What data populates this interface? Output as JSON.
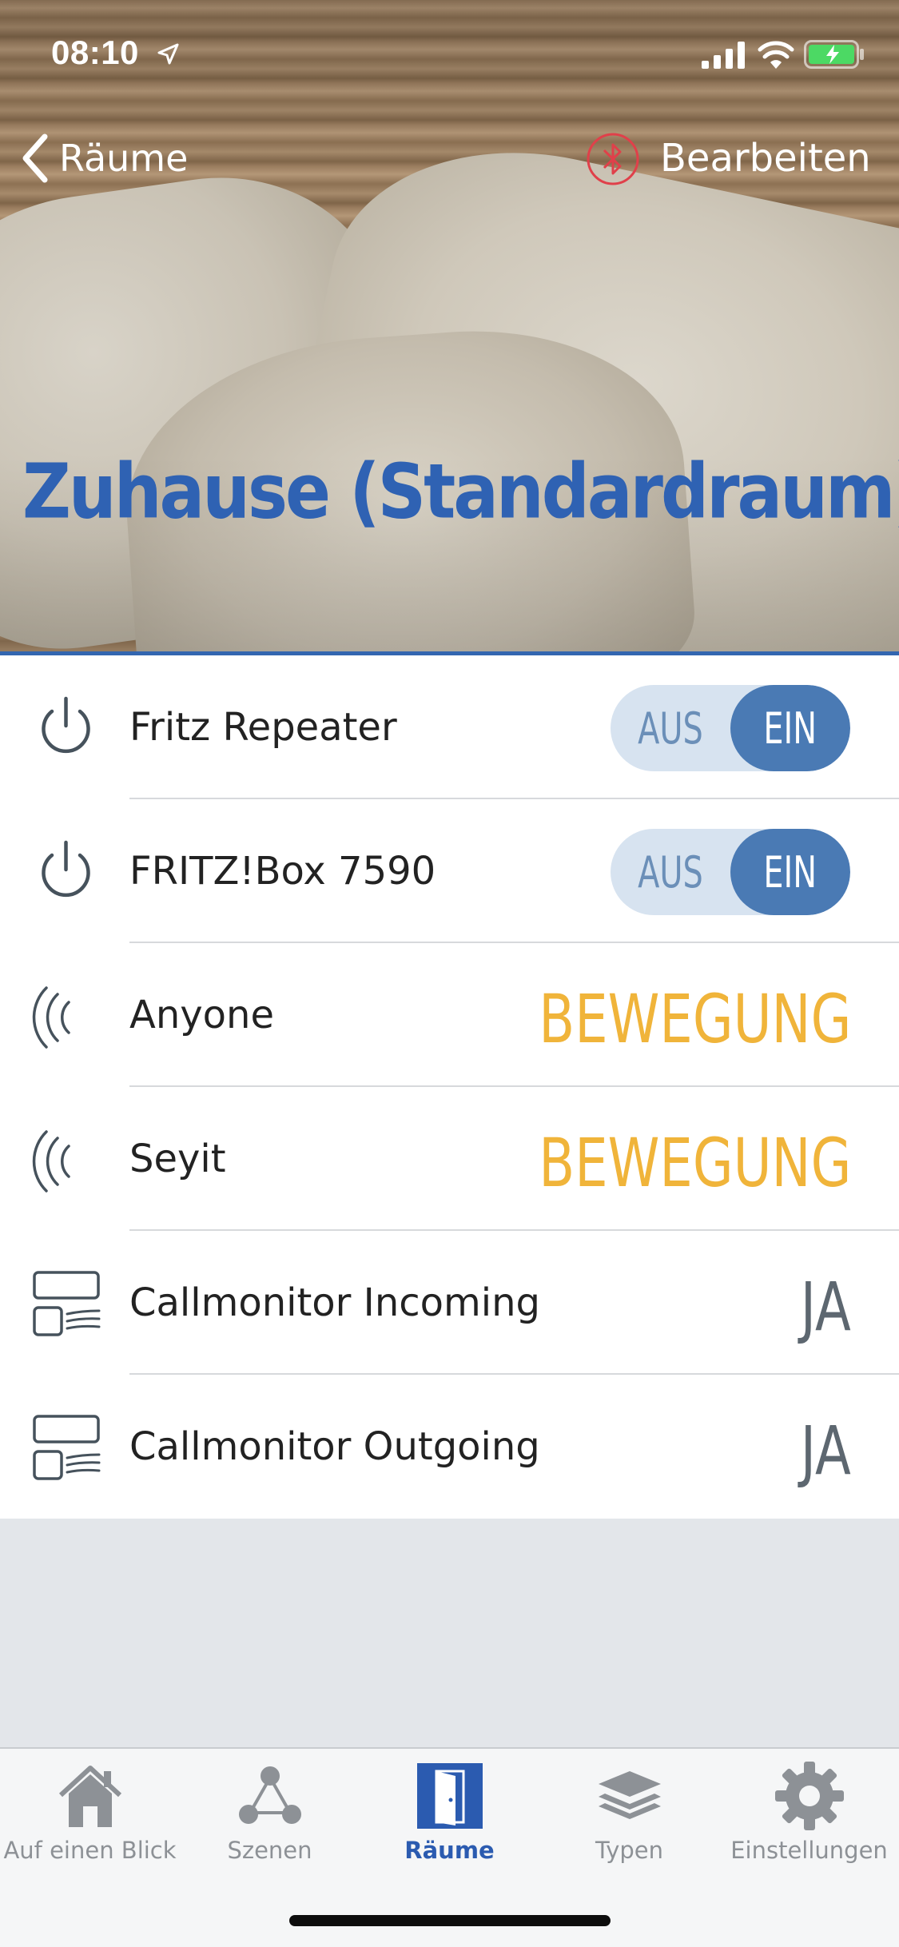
{
  "status_bar": {
    "time": "08:10"
  },
  "nav": {
    "back_label": "Räume",
    "edit_label": "Bearbeiten"
  },
  "room": {
    "title": "Zuhause (Standardraum)"
  },
  "devices": [
    {
      "name": "Fritz Repeater",
      "type": "switch",
      "off_label": "AUS",
      "on_label": "EIN",
      "state": "on",
      "icon": "power-icon"
    },
    {
      "name": "FRITZ!Box 7590",
      "type": "switch",
      "off_label": "AUS",
      "on_label": "EIN",
      "state": "on",
      "icon": "power-icon"
    },
    {
      "name": "Anyone",
      "type": "motion",
      "state_label": "BEWEGUNG",
      "icon": "motion-sensor-icon"
    },
    {
      "name": "Seyit",
      "type": "motion",
      "state_label": "BEWEGUNG",
      "icon": "motion-sensor-icon"
    },
    {
      "name": "Callmonitor Incoming",
      "type": "contact",
      "state_label": "JA",
      "icon": "callmonitor-icon"
    },
    {
      "name": "Callmonitor Outgoing",
      "type": "contact",
      "state_label": "JA",
      "icon": "callmonitor-icon"
    }
  ],
  "tabs": [
    {
      "label": "Auf einen Blick",
      "icon": "house-icon",
      "active": false
    },
    {
      "label": "Szenen",
      "icon": "scenes-icon",
      "active": false
    },
    {
      "label": "Räume",
      "icon": "door-icon",
      "active": true
    },
    {
      "label": "Typen",
      "icon": "layers-icon",
      "active": false
    },
    {
      "label": "Einstellungen",
      "icon": "gear-icon",
      "active": false
    }
  ],
  "colors": {
    "accent": "#2f62b3",
    "toggle_on": "#4a7ab4",
    "toggle_track": "#d7e3f0",
    "motion": "#f0b43a",
    "bluetooth": "#e0404a"
  }
}
